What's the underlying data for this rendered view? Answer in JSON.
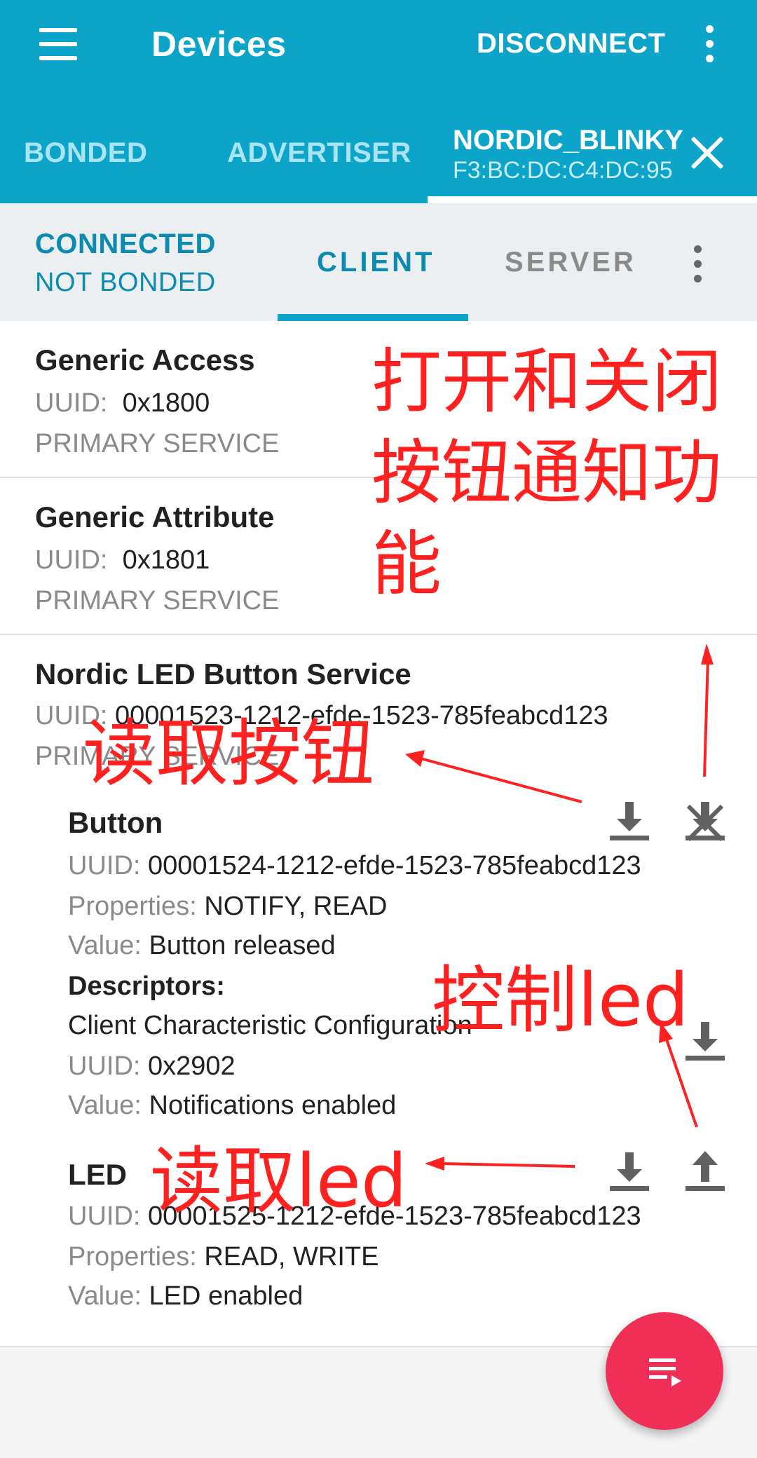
{
  "app_bar": {
    "title": "Devices",
    "disconnect_label": "DISCONNECT",
    "menu_icon": "hamburger-menu-icon",
    "overflow_icon": "more-vert-icon"
  },
  "device_tabs": {
    "tabs": [
      "BONDED",
      "ADVERTISER"
    ],
    "active_device": {
      "name": "NORDIC_BLINKY",
      "address": "F3:BC:DC:C4:DC:95"
    },
    "close_icon": "close-icon"
  },
  "connection": {
    "state": "CONNECTED",
    "bond_state": "NOT BONDED",
    "tabs": [
      "CLIENT",
      "SERVER"
    ],
    "selected_tab": "CLIENT"
  },
  "services": [
    {
      "name": "Generic Access",
      "uuid_label": "UUID:",
      "uuid": "0x1800",
      "type": "PRIMARY SERVICE"
    },
    {
      "name": "Generic Attribute",
      "uuid_label": "UUID:",
      "uuid": "0x1801",
      "type": "PRIMARY SERVICE"
    },
    {
      "name": "Nordic LED Button Service",
      "uuid_label": "UUID:",
      "uuid": "00001523-1212-efde-1523-785feabcd123",
      "type": "PRIMARY SERVICE",
      "characteristics": [
        {
          "name": "Button",
          "uuid_label": "UUID:",
          "uuid": "00001524-1212-efde-1523-785feabcd123",
          "properties_label": "Properties:",
          "properties": "NOTIFY, READ",
          "value_label": "Value:",
          "value": "Button released",
          "descriptors_label": "Descriptors:",
          "descriptor": {
            "name": "Client Characteristic Configuration",
            "uuid_label": "UUID:",
            "uuid": "0x2902",
            "value_label": "Value:",
            "value": "Notifications enabled"
          }
        },
        {
          "name": "LED",
          "uuid_label": "UUID:",
          "uuid": "00001525-1212-efde-1523-785feabcd123",
          "properties_label": "Properties:",
          "properties": "READ, WRITE",
          "value_label": "Value:",
          "value": "LED enabled"
        }
      ]
    }
  ],
  "annotations": {
    "notify_toggle": [
      "打开和关闭",
      "按钮通知功",
      "能"
    ],
    "read_button": "读取按钮",
    "control_led": "控制led",
    "read_led": "读取led",
    "color": "#ff2020"
  },
  "fab": {
    "icon": "playlist-play-icon",
    "color": "#ef2f55"
  },
  "colors": {
    "primary": "#0ca5c9",
    "accent_text": "#0b8bb0",
    "secondary_text": "#8a8a8a"
  }
}
